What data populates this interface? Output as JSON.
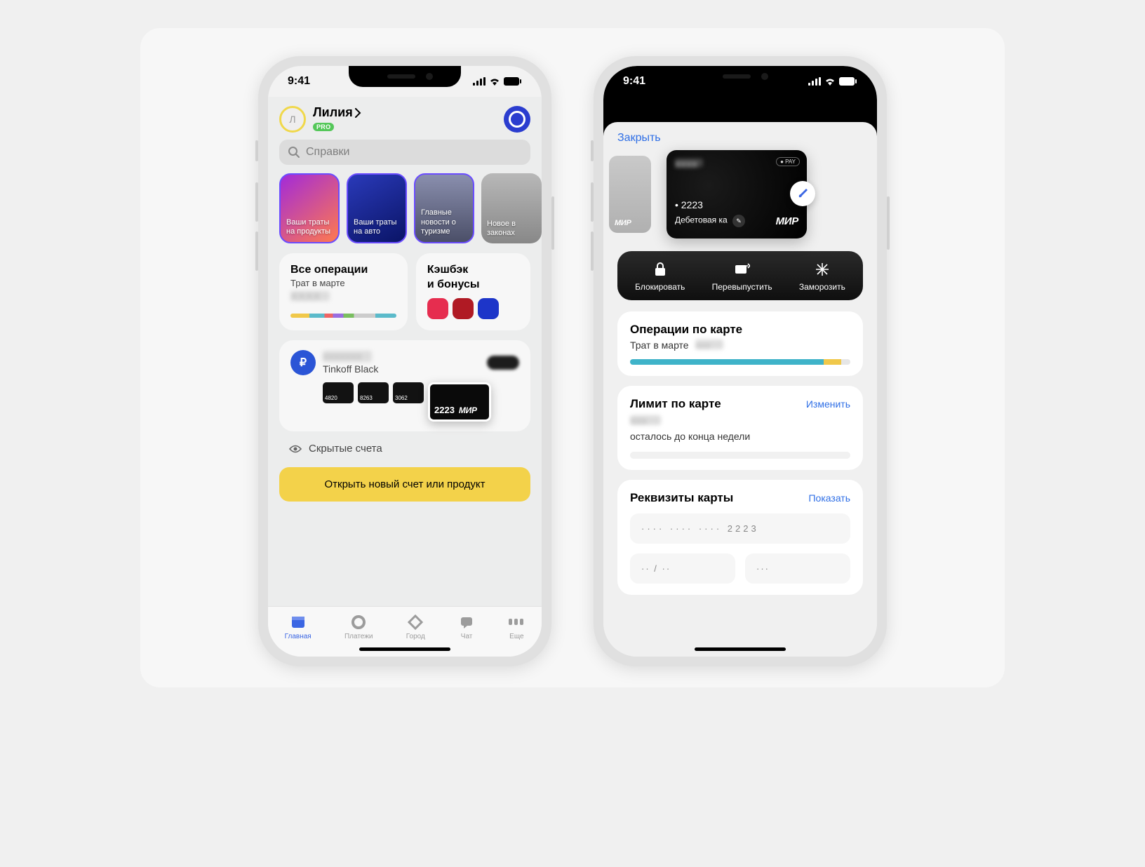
{
  "status": {
    "time": "9:41"
  },
  "left": {
    "profile": {
      "name": "Лилия",
      "initial": "Л",
      "badge": "PRO"
    },
    "search_placeholder": "Справки",
    "stories": [
      {
        "label": "Ваши траты на продукты"
      },
      {
        "label": "Ваши траты на авто"
      },
      {
        "label": "Главные новости о туризме"
      },
      {
        "label": "Новое в законах"
      }
    ],
    "ops_card": {
      "title": "Все операции",
      "sub": "Трат в марте"
    },
    "cashback_card": {
      "title_a": "Кэшбэк",
      "title_b": "и бонусы"
    },
    "account": {
      "name": "Tinkoff Black",
      "mini": [
        "4820",
        "8263",
        "3062"
      ],
      "big_last4": "2223",
      "mir": "МИР"
    },
    "hidden_accounts": "Скрытые счета",
    "cta": "Открыть новый счет или продукт",
    "tabs": {
      "home": "Главная",
      "payments": "Платежи",
      "city": "Город",
      "chat": "Чат",
      "more": "Еще"
    }
  },
  "right": {
    "close": "Закрыть",
    "ghost_mir": "МИР",
    "card": {
      "last4_line": "• 2223",
      "type": "Дебетовая ка",
      "mir": "МИР",
      "pay": "● PAY"
    },
    "actions": {
      "block": "Блокировать",
      "reissue": "Перевыпустить",
      "freeze": "Заморозить"
    },
    "ops_panel": {
      "title": "Операции по карте",
      "sub": "Трат в марте"
    },
    "limit_panel": {
      "title": "Лимит по карте",
      "link": "Изменить",
      "sub": "осталось до конца недели"
    },
    "details_panel": {
      "title": "Реквизиты карты",
      "link": "Показать",
      "pan": "···· ···· ···· 2223",
      "exp": "·· / ··",
      "cvc": "···"
    }
  }
}
